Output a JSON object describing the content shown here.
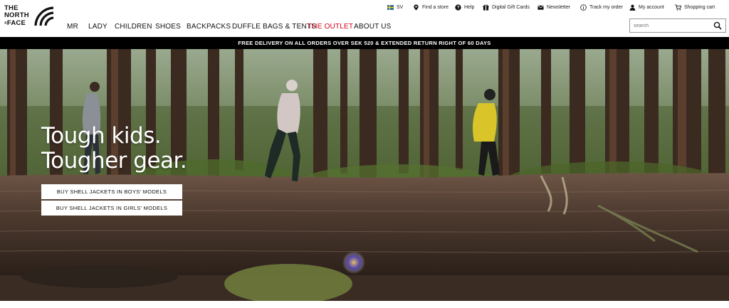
{
  "brand": {
    "logo_lines": [
      "THE",
      "NORTH",
      "FACE"
    ],
    "logo_prefix": "®"
  },
  "main_nav": [
    "MR",
    "LADY",
    "CHILDREN",
    "SHOES",
    "BACKPACKS",
    "DUFFLE BAGS & TENTS",
    "THE OUTLET",
    "ABOUT US"
  ],
  "util_nav": {
    "language": "SV",
    "find_store": "Find a store",
    "help": "Help",
    "gift_cards": "Digital Gift Cards",
    "newsletter": "Newsletter",
    "track_order": "Track my order",
    "account": "My account",
    "cart": "Shopping cart"
  },
  "search": {
    "placeholder": "search"
  },
  "promo": {
    "text": "FREE DELIVERY ON ALL ORDERS OVER SEK 520 & EXTENDED RETURN RIGHT OF 60 DAYS"
  },
  "hero": {
    "headline_line1": "Tough kids.",
    "headline_line2": "Tougher gear.",
    "cta_boys": "BUY SHELL JACKETS IN BOYS' MODELS",
    "cta_girls": "BUY SHELL JACKETS IN GIRLS' MODELS"
  },
  "colors": {
    "outlet": "#d0021b",
    "promo_bg": "#000000",
    "text": "#111111"
  }
}
